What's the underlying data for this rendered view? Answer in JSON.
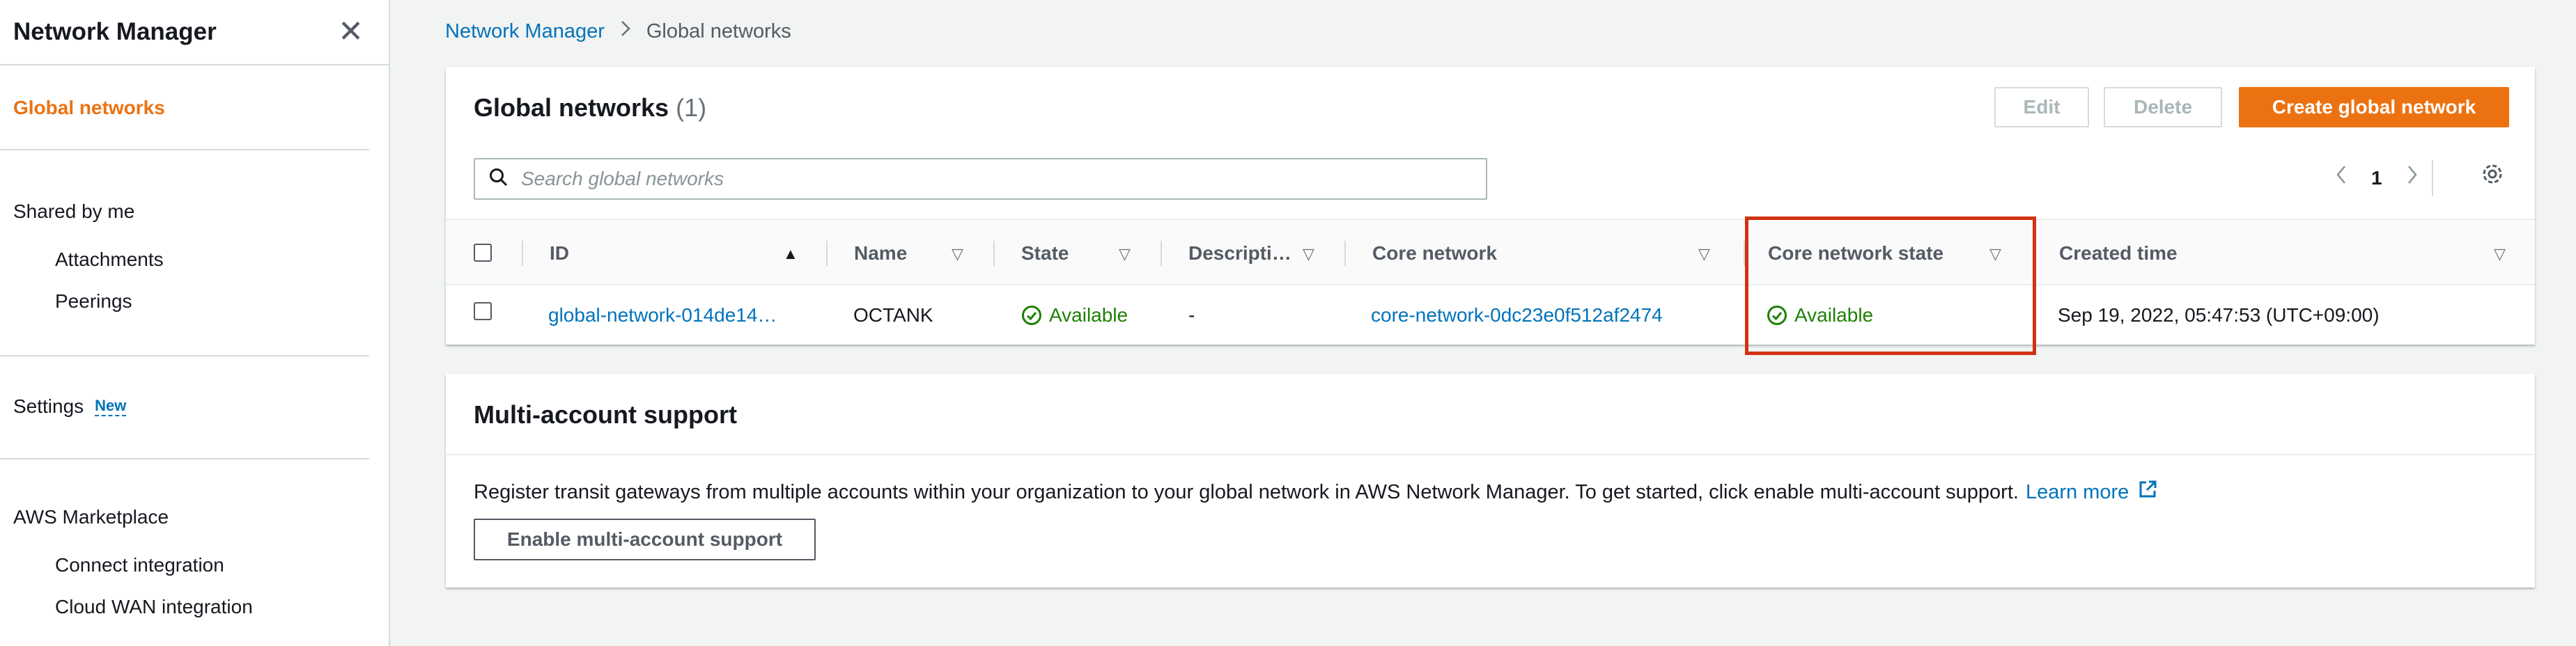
{
  "sidebar": {
    "title": "Network Manager",
    "close_icon": "close-icon",
    "items": {
      "global_networks": "Global networks",
      "shared_by_me": "Shared by me",
      "attachments": "Attachments",
      "peerings": "Peerings",
      "settings": "Settings",
      "settings_badge": "New",
      "aws_marketplace": "AWS Marketplace",
      "connect_integration": "Connect integration",
      "cloud_wan_integration": "Cloud WAN integration"
    }
  },
  "breadcrumb": {
    "root": "Network Manager",
    "current": "Global networks"
  },
  "global_networks_panel": {
    "title": "Global networks",
    "count": "(1)",
    "buttons": {
      "edit": "Edit",
      "delete": "Delete",
      "create": "Create global network"
    },
    "search": {
      "placeholder": "Search global networks",
      "value": ""
    },
    "pagination": {
      "current_page": "1"
    },
    "columns": {
      "id": "ID",
      "name": "Name",
      "state": "State",
      "description": "Descripti…",
      "core_network": "Core network",
      "core_network_state": "Core network state",
      "created_time": "Created time"
    },
    "rows": [
      {
        "id": "global-network-014de14…",
        "name": "OCTANK",
        "state": "Available",
        "description": "-",
        "core_network": "core-network-0dc23e0f512af2474",
        "core_network_state": "Available",
        "created_time": "Sep 19, 2022, 05:47:53 (UTC+09:00)"
      }
    ]
  },
  "multi_account_panel": {
    "title": "Multi-account support",
    "description": "Register transit gateways from multiple accounts within your organization to your global network in AWS Network Manager. To get started, click enable multi-account support.",
    "learn_more": "Learn more",
    "button": "Enable multi-account support"
  },
  "colors": {
    "accent_orange": "#ec7211",
    "link_blue": "#0073bb",
    "success_green": "#1d8102",
    "highlight_red": "#d13212"
  }
}
